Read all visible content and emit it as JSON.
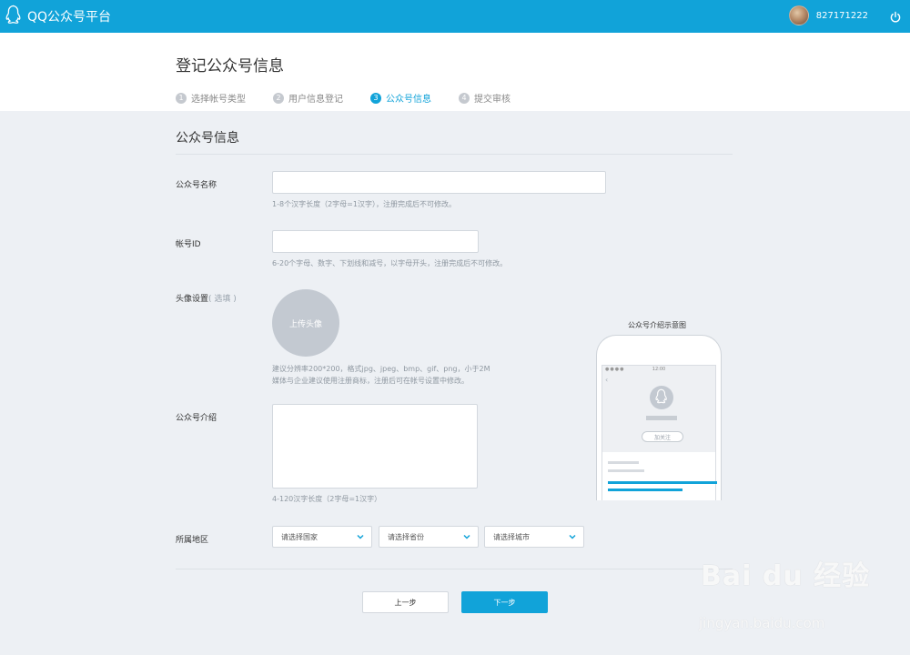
{
  "topbar": {
    "app_title": "QQ公众号平台",
    "username": "827171222"
  },
  "header": {
    "page_title": "登记公众号信息",
    "steps": [
      {
        "num": "1",
        "label": "选择帐号类型",
        "active": false
      },
      {
        "num": "2",
        "label": "用户信息登记",
        "active": false
      },
      {
        "num": "3",
        "label": "公众号信息",
        "active": true
      },
      {
        "num": "4",
        "label": "提交审核",
        "active": false
      }
    ]
  },
  "form": {
    "section_title": "公众号信息",
    "name": {
      "label": "公众号名称",
      "value": "",
      "hint": "1-8个汉字长度（2字母=1汉字），注册完成后不可修改。"
    },
    "account_id": {
      "label": "帐号ID",
      "value": "",
      "hint": "6-20个字母、数字、下划线和减号，以字母开头，注册完成后不可修改。"
    },
    "avatar": {
      "label": "头像设置",
      "optional": "( 选填 )",
      "upload_label": "上传头像",
      "hint_1": "建议分辨率200*200，格式jpg、jpeg、bmp、gif、png，小于2M",
      "hint_2": "媒体与企业建议使用注册商标，注册后可在帐号设置中修改。"
    },
    "intro": {
      "label": "公众号介绍",
      "value": "",
      "hint": "4-120汉字长度（2字母=1汉字）"
    },
    "region": {
      "label": "所属地区",
      "country": "请选择国家",
      "province": "请选择省份",
      "city": "请选择城市"
    },
    "buttons": {
      "prev": "上一步",
      "next": "下一步"
    }
  },
  "preview": {
    "title": "公众号介绍示意图",
    "status_time": "12:00",
    "follow_label": "加关注"
  },
  "watermark": {
    "logo": "Bai du 经验",
    "url": "jingyan.baidu.com"
  },
  "colors": {
    "accent": "#11a3d9",
    "page_bg": "#edf0f4",
    "placeholder_gray": "#c3c9d1"
  }
}
